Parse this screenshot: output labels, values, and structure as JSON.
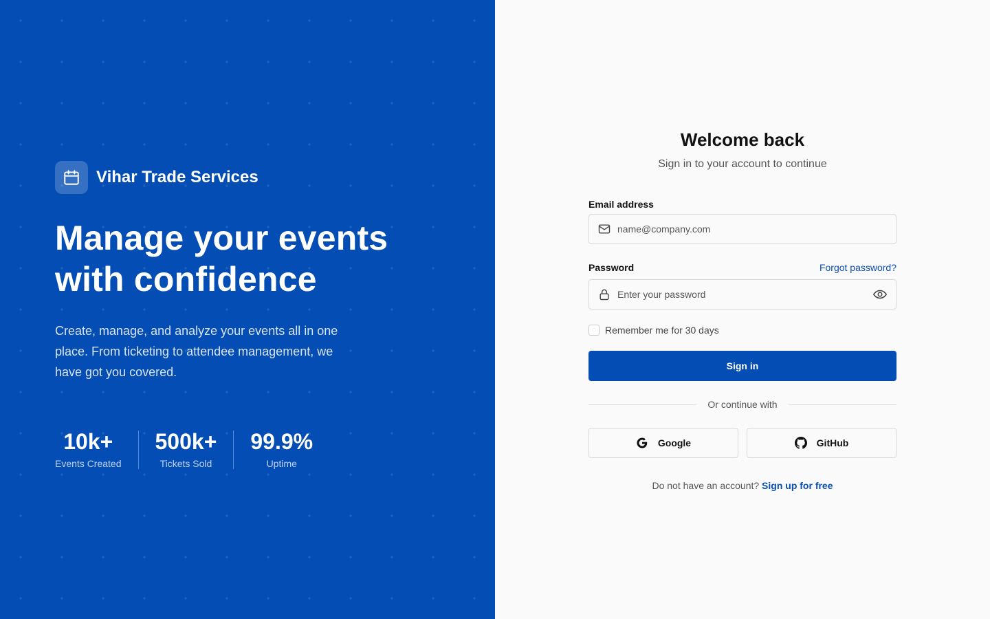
{
  "brand": {
    "name": "Vihar Trade Services",
    "logo_icon": "calendar-icon"
  },
  "hero": {
    "title": "Manage your events with confidence",
    "description": "Create, manage, and analyze your events all in one place. From ticketing to attendee management, we have got you covered."
  },
  "stats": [
    {
      "value": "10k+",
      "label": "Events Created"
    },
    {
      "value": "500k+",
      "label": "Tickets Sold"
    },
    {
      "value": "99.9%",
      "label": "Uptime"
    }
  ],
  "form": {
    "title": "Welcome back",
    "subtitle": "Sign in to your account to continue",
    "email_label": "Email address",
    "email_placeholder": "name@company.com",
    "email_value": "",
    "password_label": "Password",
    "forgot_label": "Forgot password?",
    "password_placeholder": "Enter your password",
    "password_value": "",
    "remember_label": "Remember me for 30 days",
    "remember_checked": false,
    "signin_label": "Sign in",
    "divider_text": "Or continue with",
    "google_label": "Google",
    "github_label": "GitHub",
    "signup_prompt": "Do not have an account?",
    "signup_link": "Sign up for free"
  },
  "colors": {
    "primary": "#044db4",
    "link": "#0a4fb0",
    "background": "#fafafa"
  }
}
